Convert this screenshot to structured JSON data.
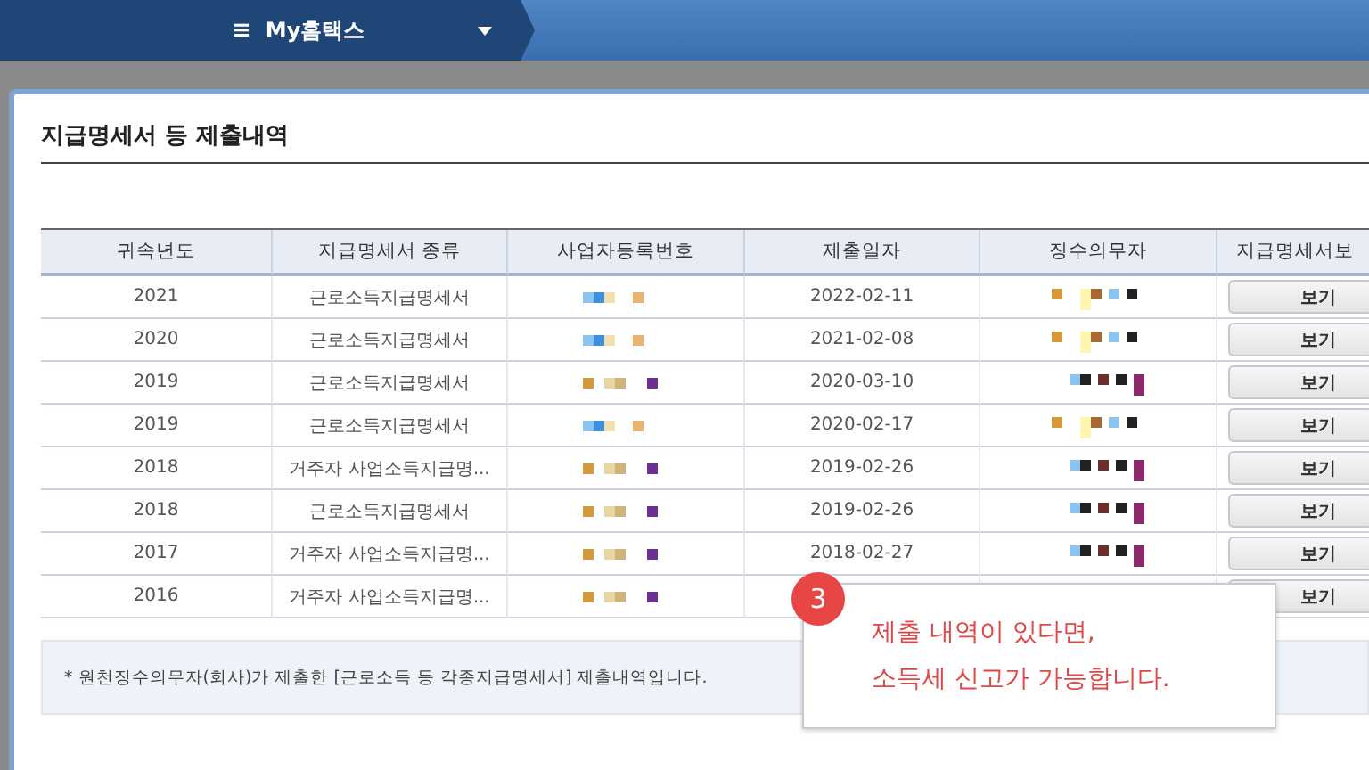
{
  "top_bar": {
    "menu_icon": "≡",
    "title": "My홈택스"
  },
  "section_title": "지급명세서 등 제출내역",
  "table": {
    "columns": [
      "귀속년도",
      "지급명세서 종류",
      "사업자등록번호",
      "제출일자",
      "징수의무자",
      "지급명세서보"
    ],
    "rows": [
      {
        "year": "2021",
        "type": "근로소득지급명세서",
        "date": "2022-02-11",
        "action": "보기"
      },
      {
        "year": "2020",
        "type": "근로소득지급명세서",
        "date": "2021-02-08",
        "action": "보기"
      },
      {
        "year": "2019",
        "type": "근로소득지급명세서",
        "date": "2020-03-10",
        "action": "보기"
      },
      {
        "year": "2019",
        "type": "근로소득지급명세서",
        "date": "2020-02-17",
        "action": "보기"
      },
      {
        "year": "2018",
        "type": "거주자 사업소득지급명...",
        "date": "2019-02-26",
        "action": "보기"
      },
      {
        "year": "2018",
        "type": "근로소득지급명세서",
        "date": "2019-02-26",
        "action": "보기"
      },
      {
        "year": "2017",
        "type": "거주자 사업소득지급명...",
        "date": "2018-02-27",
        "action": "보기"
      },
      {
        "year": "2016",
        "type": "거주자 사업소득지급명...",
        "date": null,
        "action": "보기"
      }
    ]
  },
  "note": "* 원천징수의무자(회사)가 제출한 [근로소득 등 각종지급명세서] 제출내역입니다.",
  "callout": {
    "step": "3",
    "lines": [
      "제출 내역이 있다면,",
      "소득세 신고가 가능합니다."
    ]
  }
}
